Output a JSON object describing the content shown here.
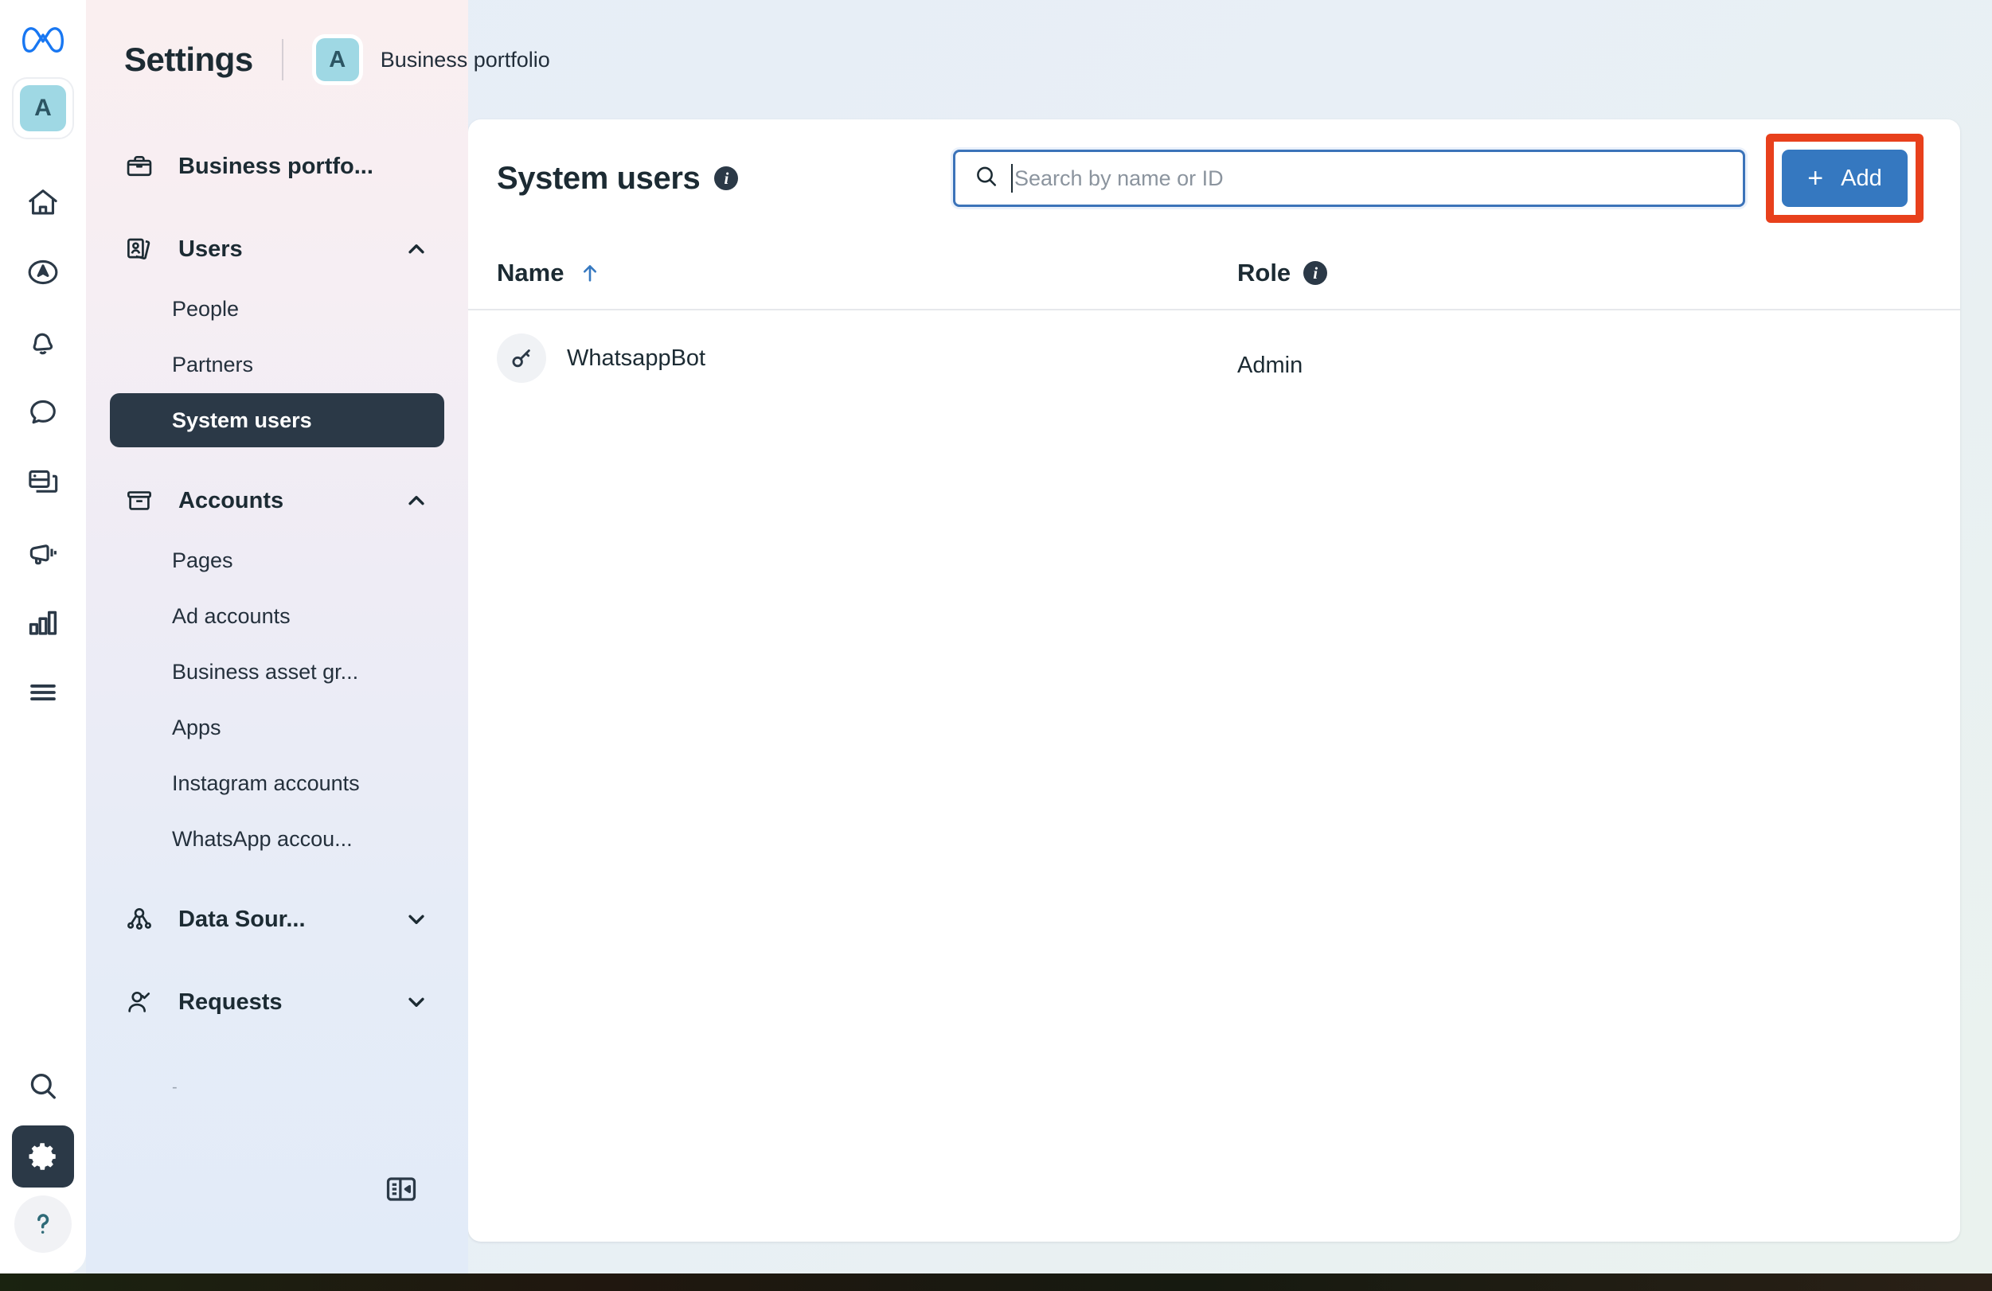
{
  "rail": {
    "logo": "meta-logo",
    "avatar_initial": "A",
    "icons": [
      {
        "name": "home-icon"
      },
      {
        "name": "compass-icon"
      },
      {
        "name": "bell-icon"
      },
      {
        "name": "chat-bubble-icon"
      },
      {
        "name": "pages-cards-icon"
      },
      {
        "name": "megaphone-icon"
      },
      {
        "name": "bar-chart-icon"
      },
      {
        "name": "hamburger-menu-icon"
      }
    ],
    "bottom_icons": [
      {
        "name": "search-icon"
      },
      {
        "name": "gear-icon",
        "active": true
      },
      {
        "name": "help-icon",
        "glyph": "?"
      }
    ]
  },
  "header": {
    "title": "Settings",
    "portfolio_initial": "A",
    "portfolio_label": "Business portfolio"
  },
  "nav": {
    "groups": [
      {
        "label": "Business portfo...",
        "icon": "briefcase-icon",
        "chevron": null,
        "items": []
      },
      {
        "label": "Users",
        "icon": "id-card-icon",
        "chevron": "up",
        "items": [
          {
            "label": "People",
            "active": false
          },
          {
            "label": "Partners",
            "active": false
          },
          {
            "label": "System users",
            "active": true
          }
        ]
      },
      {
        "label": "Accounts",
        "icon": "archive-box-icon",
        "chevron": "up",
        "items": [
          {
            "label": "Pages",
            "active": false
          },
          {
            "label": "Ad accounts",
            "active": false
          },
          {
            "label": "Business asset gr...",
            "active": false
          },
          {
            "label": "Apps",
            "active": false
          },
          {
            "label": "Instagram accounts",
            "active": false
          },
          {
            "label": "WhatsApp accou...",
            "active": false
          }
        ]
      },
      {
        "label": "Data Sour...",
        "icon": "data-sources-icon",
        "chevron": "down",
        "items": []
      },
      {
        "label": "Requests",
        "icon": "user-check-icon",
        "chevron": "down",
        "items": []
      }
    ],
    "collapse_icon": "collapse-panel-icon"
  },
  "main": {
    "page_title": "System users",
    "title_info_icon": "info-icon",
    "search": {
      "placeholder": "Search by name or ID",
      "value": "",
      "icon": "search-icon",
      "focused": true
    },
    "add_button": {
      "label": "Add",
      "plus": "+",
      "highlighted": true
    },
    "table": {
      "columns": [
        {
          "label": "Name",
          "sort": "asc"
        },
        {
          "label": "Role",
          "info": true
        }
      ],
      "rows": [
        {
          "icon": "key-icon",
          "name": "WhatsappBot",
          "role": "Admin"
        }
      ]
    }
  },
  "colors": {
    "accent_blue": "#3578c0",
    "highlight_red": "#e8401c",
    "active_nav": "#2b3947",
    "avatar_bg": "#9fd8e4",
    "meta_blue": "#1877f2"
  }
}
